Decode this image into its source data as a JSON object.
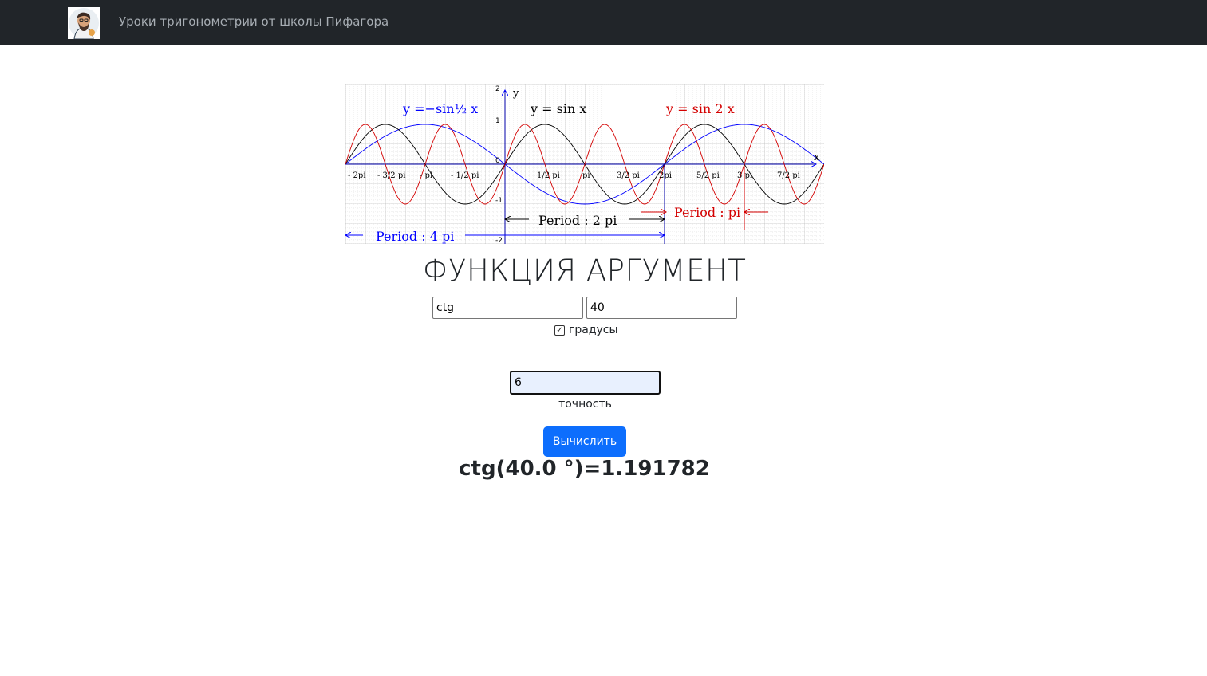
{
  "navbar": {
    "brand": "Уроки тригонометрии от школы Пифагора"
  },
  "graph": {
    "y_axis_label": "y",
    "x_axis_label": "x",
    "y_ticks": [
      "2",
      "1",
      "0",
      "-1",
      "-2"
    ],
    "formula_blue": "y =−sin½ x",
    "formula_black": "y =  sin x",
    "formula_red": "y =  sin 2 x",
    "x_ticks": [
      "- 2pi",
      "- 3/2 pi",
      "- pi",
      "- 1/2 pi",
      "1/2 pi",
      "pi",
      "3/2 pi",
      "2pi",
      "5/2 pi",
      "3 pi",
      "7/2 pi"
    ],
    "period_black": "Period : 2 pi",
    "period_red": "Period : pi",
    "period_blue": "Period : 4 pi",
    "colors": {
      "blue": "#0000ff",
      "black": "#000000",
      "red": "#d40000",
      "grid": "#c8c8c8"
    }
  },
  "title": "ФУНКЦИЯ АРГУМЕНТ",
  "form": {
    "function_value": "ctg",
    "argument_value": "40",
    "degrees_checked": "✓",
    "degrees_label": "градусы",
    "precision_value": "6",
    "precision_label": "точность",
    "submit_label": "Вычислить"
  },
  "result": "ctg(40.0 °)=1.191782"
}
